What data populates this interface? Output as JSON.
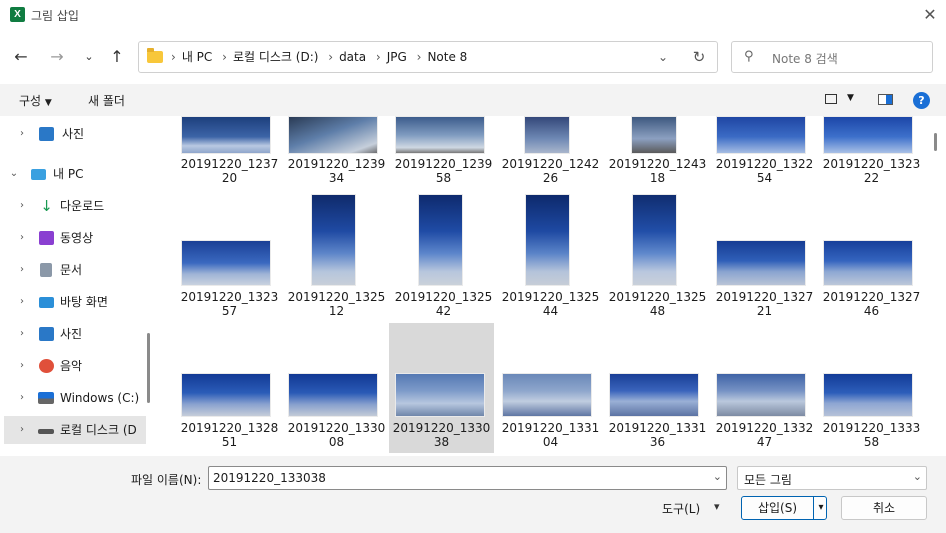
{
  "window": {
    "title": "그림 삽입",
    "app_icon_letter": "X"
  },
  "address": {
    "crumbs": [
      "내 PC",
      "로컬 디스크 (D:)",
      "data",
      "JPG",
      "Note 8"
    ]
  },
  "search": {
    "placeholder": "Note 8 검색"
  },
  "toolbar": {
    "organize": "구성",
    "new_folder": "새 폴더",
    "help": "?"
  },
  "sidebar": {
    "items": [
      {
        "label": "사진",
        "icon": "pictures-icon"
      },
      {
        "label": "내 PC",
        "icon": "pc-icon"
      },
      {
        "label": "다운로드",
        "icon": "download-icon"
      },
      {
        "label": "동영상",
        "icon": "videos-icon"
      },
      {
        "label": "문서",
        "icon": "documents-icon"
      },
      {
        "label": "바탕 화면",
        "icon": "desktop-icon"
      },
      {
        "label": "사진",
        "icon": "pictures-icon"
      },
      {
        "label": "음악",
        "icon": "music-icon"
      },
      {
        "label": "Windows (C:)",
        "icon": "drive-icon"
      },
      {
        "label": "로컬 디스크 (D",
        "icon": "drive-icon"
      }
    ]
  },
  "files": [
    {
      "name": "20191220_123720"
    },
    {
      "name": "20191220_123934"
    },
    {
      "name": "20191220_123958"
    },
    {
      "name": "20191220_124226"
    },
    {
      "name": "20191220_124318"
    },
    {
      "name": "20191220_132254"
    },
    {
      "name": "20191220_132322"
    },
    {
      "name": "20191220_132357"
    },
    {
      "name": "20191220_132512"
    },
    {
      "name": "20191220_132542"
    },
    {
      "name": "20191220_132544"
    },
    {
      "name": "20191220_132548"
    },
    {
      "name": "20191220_132721"
    },
    {
      "name": "20191220_132746"
    },
    {
      "name": "20191220_132851"
    },
    {
      "name": "20191220_133008"
    },
    {
      "name": "20191220_133038",
      "selected": true
    },
    {
      "name": "20191220_133104"
    },
    {
      "name": "20191220_133136"
    },
    {
      "name": "20191220_133247"
    },
    {
      "name": "20191220_133358"
    }
  ],
  "bottom": {
    "filename_label": "파일 이름(N):",
    "filename_value": "20191220_133038",
    "filter_value": "모든 그림",
    "tools_label": "도구(L)",
    "insert_label": "삽입(S)",
    "cancel_label": "취소"
  },
  "colors": {
    "accent": "#0063b1",
    "excel": "#107c41",
    "help": "#1a6fd6"
  }
}
